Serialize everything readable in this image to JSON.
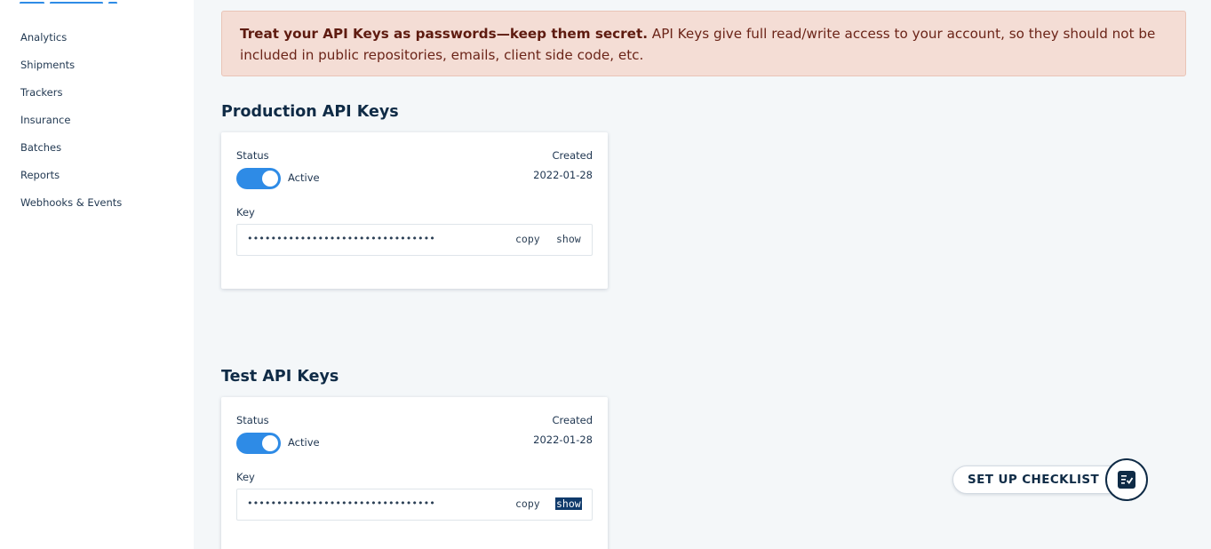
{
  "sidebar": {
    "items": [
      {
        "label": "Analytics"
      },
      {
        "label": "Shipments"
      },
      {
        "label": "Trackers"
      },
      {
        "label": "Insurance"
      },
      {
        "label": "Batches"
      },
      {
        "label": "Reports"
      },
      {
        "label": "Webhooks & Events"
      }
    ]
  },
  "alert": {
    "bold": "Treat your API Keys as passwords—keep them secret.",
    "text": " API Keys give full read/write access to your account, so they should not be included in public repositories, emails, client side code, etc."
  },
  "production": {
    "title": "Production API Keys",
    "status_label": "Status",
    "status_value": "Active",
    "created_label": "Created",
    "created_value": "2022-01-28",
    "key_label": "Key",
    "key_masked": "••••••••••••••••••••••••••••••••",
    "copy_label": "copy",
    "show_label": "show"
  },
  "test": {
    "title": "Test API Keys",
    "status_label": "Status",
    "status_value": "Active",
    "created_label": "Created",
    "created_value": "2022-01-28",
    "key_label": "Key",
    "key_masked": "••••••••••••••••••••••••••••••••",
    "copy_label": "copy",
    "show_label": "show"
  },
  "checklist": {
    "label": "SET UP CHECKLIST",
    "icon": "checklist-icon"
  },
  "colors": {
    "accent": "#2e8be6",
    "navy": "#0f2b46",
    "alert_bg": "#f4ddd5",
    "alert_text": "#6b2418"
  }
}
